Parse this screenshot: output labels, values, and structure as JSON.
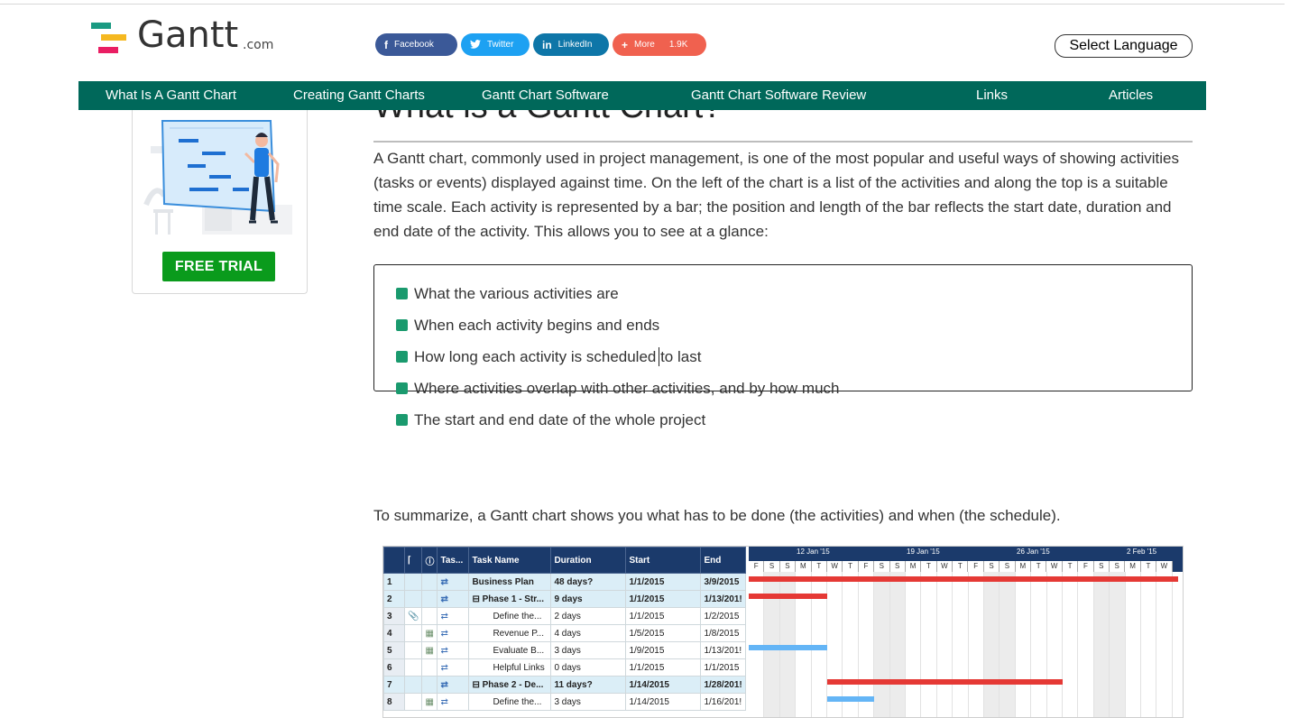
{
  "header": {
    "logo_word": "Gantt",
    "logo_suffix": ".com",
    "share": {
      "facebook": "Facebook",
      "twitter": "Twitter",
      "linkedin": "LinkedIn",
      "more": "More",
      "more_count": "1.9K"
    },
    "language_button": "Select Language"
  },
  "nav": {
    "items": [
      {
        "label": "What Is A Gantt Chart"
      },
      {
        "label": "Creating Gantt Charts"
      },
      {
        "label": "Gantt Chart Software"
      },
      {
        "label": "Gantt Chart Software Review"
      },
      {
        "label": "Links"
      },
      {
        "label": "Articles"
      }
    ]
  },
  "sidebar": {
    "cta": "FREE TRIAL"
  },
  "main": {
    "heading": "What is a Gantt Chart?",
    "intro": "A Gantt chart, commonly used in project management, is one of the most popular and useful ways of showing activities (tasks or events) displayed against time. On the left of the chart is a list of the activities and along the top is a suitable time scale. Each activity is represented by a bar; the position and length of the bar reflects the start date, duration and end date of the activity. This allows you to see at a glance:",
    "bullets": [
      "What the various activities are",
      "When each activity begins and ends",
      "How long each activity is scheduled to last",
      "Where activities overlap with other activities, and by how much",
      "The start and end date of the whole project"
    ],
    "summary": "To summarize, a Gantt chart shows you what has to be done (the activities) and when (the schedule)."
  },
  "gantt_image": {
    "columns": [
      "Tas...",
      "Task Name",
      "Duration",
      "Start",
      "End"
    ],
    "rows": [
      {
        "n": "1",
        "name": "Business Plan",
        "duration": "48 days?",
        "start": "1/1/2015",
        "end": "3/9/2015"
      },
      {
        "n": "2",
        "name": "⊟ Phase 1 - Str...",
        "duration": "9 days",
        "start": "1/1/2015",
        "end": "1/13/201!"
      },
      {
        "n": "3",
        "name": "Define the...",
        "duration": "2 days",
        "start": "1/1/2015",
        "end": "1/2/2015"
      },
      {
        "n": "4",
        "name": "Revenue P...",
        "duration": "4 days",
        "start": "1/5/2015",
        "end": "1/8/2015"
      },
      {
        "n": "5",
        "name": "Evaluate B...",
        "duration": "3 days",
        "start": "1/9/2015",
        "end": "1/13/201!"
      },
      {
        "n": "6",
        "name": "Helpful Links",
        "duration": "0 days",
        "start": "1/1/2015",
        "end": "1/1/2015"
      },
      {
        "n": "7",
        "name": "⊟ Phase 2 - De...",
        "duration": "11 days?",
        "start": "1/14/2015",
        "end": "1/28/201!"
      },
      {
        "n": "8",
        "name": "Define the...",
        "duration": "3 days",
        "start": "1/14/2015",
        "end": "1/16/201!"
      }
    ],
    "weeks": [
      "12 Jan '15",
      "19 Jan '15",
      "26 Jan '15",
      "2 Feb '15"
    ],
    "days": [
      "F",
      "S",
      "S",
      "M",
      "T",
      "W",
      "T",
      "F",
      "S",
      "S",
      "M",
      "T",
      "W",
      "T",
      "F",
      "S",
      "S",
      "M",
      "T",
      "W",
      "T",
      "F",
      "S",
      "S",
      "M",
      "T",
      "W"
    ],
    "colors": {
      "summary_bar": "#e53935",
      "task_bar": "#64b5f6",
      "header": "#1b3a6b"
    }
  },
  "colors": {
    "nav_bg": "#00685a",
    "cta_bg": "#0a9b1c",
    "bullet": "#1a9a6e"
  }
}
